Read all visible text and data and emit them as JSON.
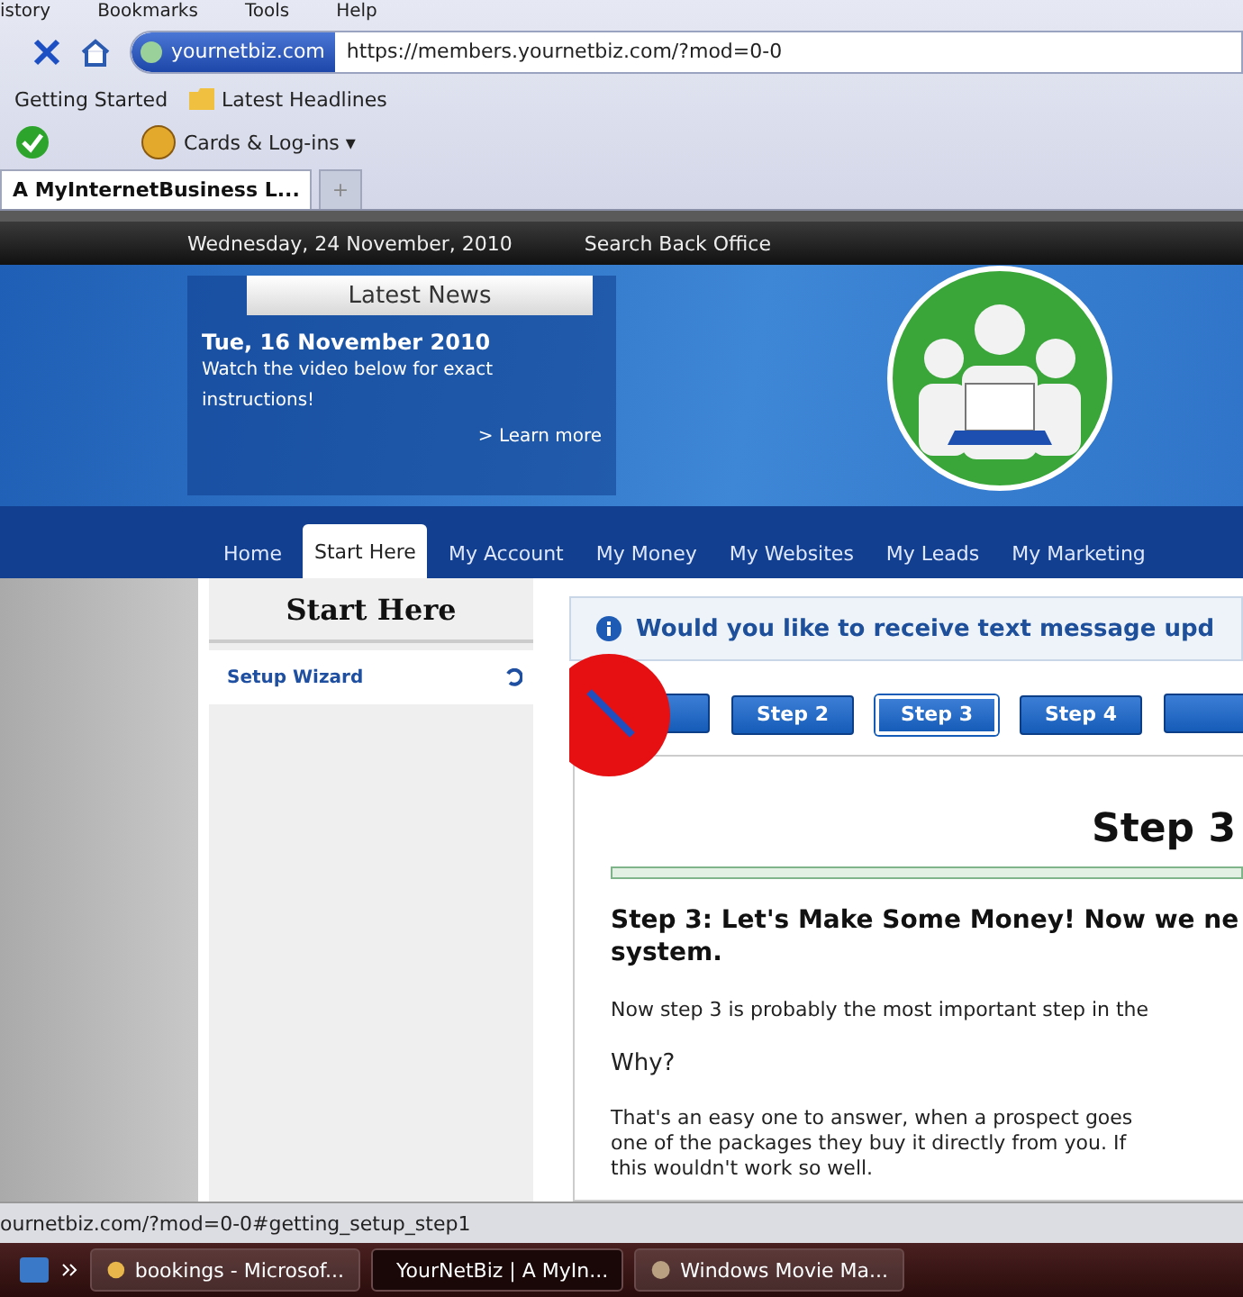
{
  "menu_bar": [
    "istory",
    "Bookmarks",
    "Tools",
    "Help"
  ],
  "address_bar": {
    "site_badge": "yournetbiz.com",
    "url": "https://members.yournetbiz.com/?mod=0-0"
  },
  "bookmarks": [
    "Getting Started",
    "Latest Headlines"
  ],
  "toolbar": {
    "cards_label": "Cards & Log-ins",
    "caret": "▾"
  },
  "tabs": [
    {
      "label": "A MyInternetBusiness L...",
      "selected": true
    },
    {
      "label": "+",
      "selected": false
    }
  ],
  "top_bar": {
    "date": "Wednesday, 24 November, 2010",
    "link": "Search Back Office"
  },
  "news": {
    "title": "Latest News",
    "date": "Tue, 16 November 2010",
    "text": "Watch the video below for exact instructions!",
    "link": "> Learn more"
  },
  "nav": [
    {
      "label": "Home",
      "selected": false
    },
    {
      "label": "Start Here",
      "selected": true
    },
    {
      "label": "My Account",
      "selected": false
    },
    {
      "label": "My Money",
      "selected": false
    },
    {
      "label": "My Websites",
      "selected": false
    },
    {
      "label": "My Leads",
      "selected": false
    },
    {
      "label": "My Marketing",
      "selected": false
    }
  ],
  "sidebar": {
    "title": "Start Here",
    "items": [
      {
        "label": "Setup Wizard",
        "selected": true
      }
    ]
  },
  "notice": "Would you like to receive text message upd",
  "steps": [
    {
      "selected": false
    },
    {
      "label": "Step 2",
      "selected": false
    },
    {
      "label": "Step 3",
      "selected": true
    },
    {
      "label": "Step 4",
      "selected": false
    },
    {
      "selected": false
    }
  ],
  "content": {
    "title": "Step 3",
    "heading": [
      "Step 3: Let's Make Some Money! Now we ne",
      "system."
    ],
    "paragraphs": [
      [
        "Now step 3 is probably the most important step in the"
      ],
      [
        "Why?"
      ],
      [
        "That's an easy one to answer, when a prospect goes",
        "one of the packages they buy it directly from you. If",
        "this wouldn't work so well."
      ]
    ]
  },
  "status_bar": "ournetbiz.com/?mod=0-0#getting_setup_step1",
  "taskbar": [
    {
      "label": "bookings - Microsof...",
      "selected": false
    },
    {
      "label": "YourNetBiz | A MyIn...",
      "selected": true
    },
    {
      "label": "Windows Movie Ma...",
      "selected": false
    }
  ]
}
